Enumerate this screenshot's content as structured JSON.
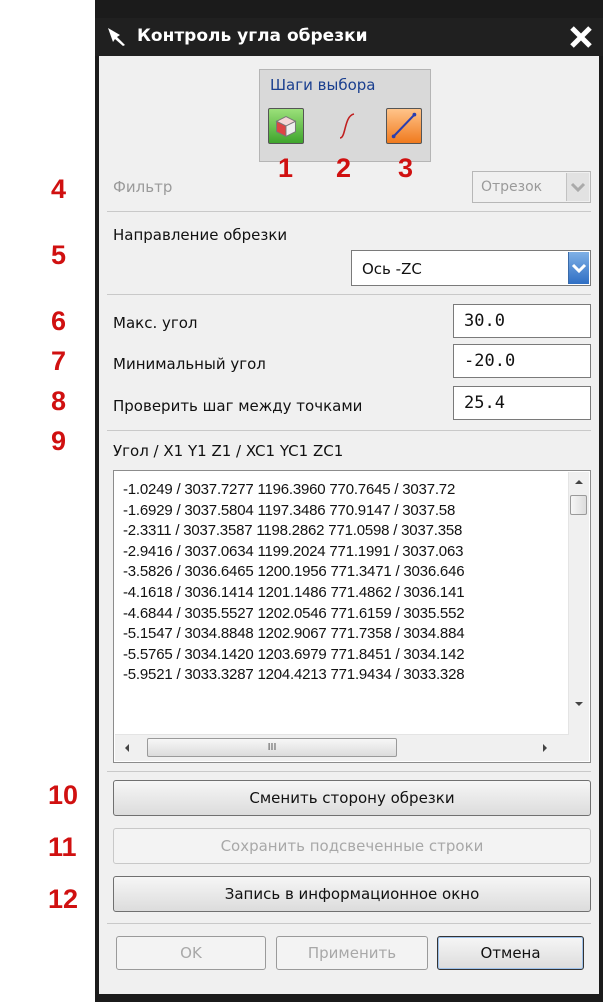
{
  "window": {
    "title": "Контроль угла обрезки"
  },
  "steps": {
    "label": "Шаги выбора"
  },
  "markers": [
    "1",
    "2",
    "3",
    "4",
    "5",
    "6",
    "7",
    "8",
    "9",
    "10",
    "11",
    "12"
  ],
  "filter": {
    "label": "Фильтр",
    "value": "Отрезок"
  },
  "direction": {
    "label": "Направление обрезки",
    "value": "Ось -ZC"
  },
  "max_angle": {
    "label": "Макс. угол",
    "value": "30.0"
  },
  "min_angle": {
    "label": "Минимальный угол",
    "value": "-20.0"
  },
  "check_step": {
    "label": "Проверить шаг между точками",
    "value": "25.4"
  },
  "list": {
    "header": "Угол / X1 Y1 Z1 / XC1 YC1 ZC1",
    "rows": [
      "-1.0249 / 3037.7277 1196.3960  770.7645 / 3037.72",
      "-1.6929 / 3037.5804 1197.3486  770.9147 / 3037.58",
      "-2.3311 / 3037.3587 1198.2862  771.0598 / 3037.358",
      "-2.9416 / 3037.0634 1199.2024  771.1991 / 3037.063",
      "-3.5826 / 3036.6465 1200.1956  771.3471 / 3036.646",
      "-4.1618 / 3036.1414 1201.1486  771.4862 / 3036.141",
      "-4.6844 / 3035.5527 1202.0546  771.6159 / 3035.552",
      "-5.1547 / 3034.8848 1202.9067  771.7358 / 3034.884",
      "-5.5765 / 3034.1420 1203.6979  771.8451 / 3034.142",
      "-5.9521 / 3033.3287 1204.4213  771.9434 / 3033.328"
    ],
    "hscroll_grip": "III"
  },
  "buttons": {
    "flip": "Сменить сторону обрезки",
    "save": "Сохранить подсвеченные строки",
    "info": "Запись в информационное окно",
    "ok": "OK",
    "apply": "Применить",
    "cancel": "Отмена"
  },
  "colors": {
    "marker": "#d01010",
    "titlebar": "#202020",
    "panel": "#f0f0f0",
    "accent": "#2f6fc4"
  },
  "icons": [
    "pin-icon",
    "close-icon",
    "face-cube-icon",
    "curve-icon",
    "line-icon",
    "chevron-down-icon"
  ]
}
